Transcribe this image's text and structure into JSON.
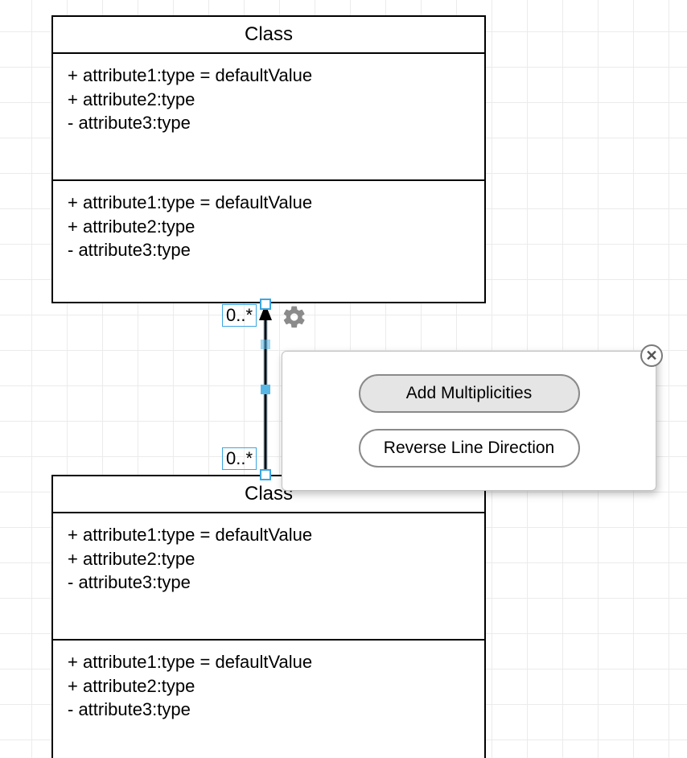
{
  "grid_size_px": 44,
  "class1": {
    "title": "Class",
    "section_a": [
      "+ attribute1:type = defaultValue",
      "+ attribute2:type",
      "- attribute3:type"
    ],
    "section_b": [
      "+ attribute1:type = defaultValue",
      "+ attribute2:type",
      "- attribute3:type"
    ]
  },
  "class2": {
    "title": "Class",
    "section_a": [
      "+ attribute1:type = defaultValue",
      "+ attribute2:type",
      "- attribute3:type"
    ],
    "section_b": [
      "+ attribute1:type = defaultValue",
      "+ attribute2:type",
      "- attribute3:type"
    ]
  },
  "connection": {
    "multiplicity_top": "0..*",
    "multiplicity_bottom": "0..*",
    "direction": "class2_to_class1",
    "arrow_end": "top"
  },
  "popup": {
    "button_primary": "Add Multiplicities",
    "button_secondary": "Reverse Line Direction"
  },
  "chart_data": {
    "type": "uml-class-diagram",
    "classes": [
      {
        "name": "Class",
        "attributes": [
          "+ attribute1:type = defaultValue",
          "+ attribute2:type",
          "- attribute3:type"
        ],
        "operations": [
          "+ attribute1:type = defaultValue",
          "+ attribute2:type",
          "- attribute3:type"
        ]
      },
      {
        "name": "Class",
        "attributes": [
          "+ attribute1:type = defaultValue",
          "+ attribute2:type",
          "- attribute3:type"
        ],
        "operations": [
          "+ attribute1:type = defaultValue",
          "+ attribute2:type",
          "- attribute3:type"
        ]
      }
    ],
    "relations": [
      {
        "from": 1,
        "to": 0,
        "type": "association-directed",
        "multiplicity_from": "0..*",
        "multiplicity_to": "0..*"
      }
    ]
  }
}
